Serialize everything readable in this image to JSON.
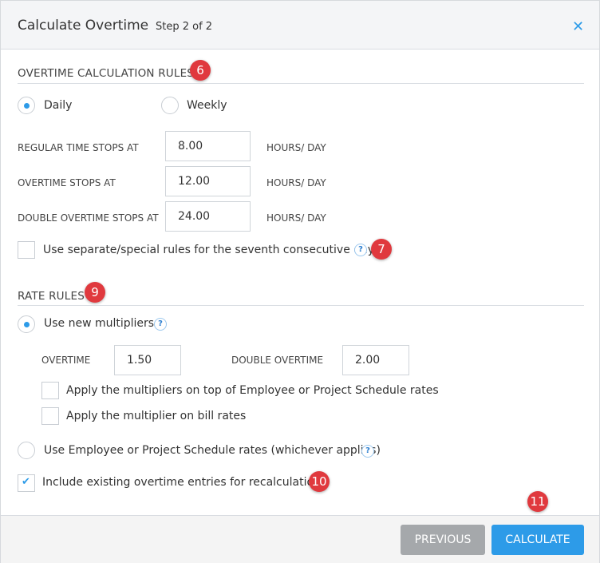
{
  "header": {
    "title": "Calculate Overtime",
    "step": "Step 2 of 2",
    "close_icon": "close-icon"
  },
  "overtime_rules": {
    "heading": "OVERTIME CALCULATION RULES",
    "badge": "6",
    "period_options": [
      {
        "label": "Daily",
        "selected": true
      },
      {
        "label": "Weekly",
        "selected": false
      }
    ],
    "fields": [
      {
        "label": "REGULAR TIME STOPS AT",
        "value": "8.00",
        "unit": "HOURS/ DAY"
      },
      {
        "label": "OVERTIME STOPS AT",
        "value": "12.00",
        "unit": "HOURS/ DAY"
      },
      {
        "label": "DOUBLE OVERTIME STOPS AT",
        "value": "24.00",
        "unit": "HOURS/ DAY"
      }
    ],
    "seventh_day": {
      "label": "Use separate/special rules for the seventh consecutive day",
      "checked": false,
      "badge": "7"
    }
  },
  "rate_rules": {
    "heading": "RATE RULES",
    "badge": "9",
    "new_multipliers": {
      "label": "Use new multipliers",
      "selected": true
    },
    "overtime": {
      "label": "OVERTIME",
      "value": "1.50"
    },
    "double_overtime": {
      "label": "DOUBLE OVERTIME",
      "value": "2.00"
    },
    "apply_on_top": {
      "label": "Apply the multipliers on top of Employee or Project Schedule rates",
      "checked": false
    },
    "apply_bill": {
      "label": "Apply the multiplier on bill rates",
      "checked": false
    },
    "schedule_rates": {
      "label": "Use Employee or Project Schedule rates (whichever applies)",
      "selected": false
    },
    "include_existing": {
      "label": "Include existing overtime entries for recalculations",
      "checked": true,
      "badge": "10"
    }
  },
  "footer": {
    "previous": "PREVIOUS",
    "calculate": "CALCULATE",
    "badge": "11"
  },
  "colors": {
    "accent": "#2d9be8",
    "secondary_button": "#a5a8ab",
    "badge": "#e0393e"
  },
  "help_glyph": "?"
}
